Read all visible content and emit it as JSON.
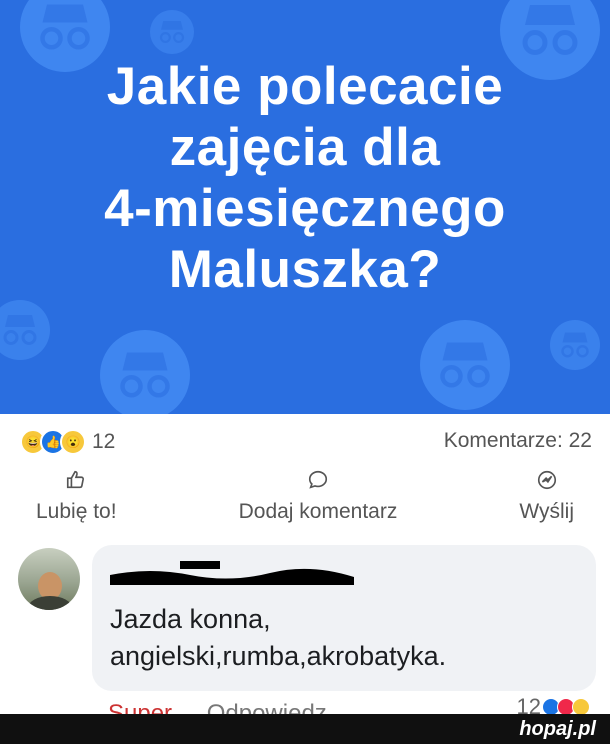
{
  "post": {
    "title": "Jakie polecacie\nzajęcia dla\n4-miesięcznego\nMaluszka?",
    "banner_color": "#2a6ee0"
  },
  "stats": {
    "reaction_icons": [
      "haha-icon",
      "like-icon",
      "wow-icon"
    ],
    "reaction_count": "12",
    "comments_label": "Komentarze: 22"
  },
  "actions": {
    "like_label": "Lubię to!",
    "comment_label": "Dodaj komentarz",
    "share_label": "Wyślij"
  },
  "comment": {
    "text": "Jazda konna,\nangielski,rumba,akrobatyka.",
    "reaction_count": "12",
    "reply_partial": "Odpowiedz",
    "like_partial": "Super"
  },
  "watermark": "hopaj.pl"
}
